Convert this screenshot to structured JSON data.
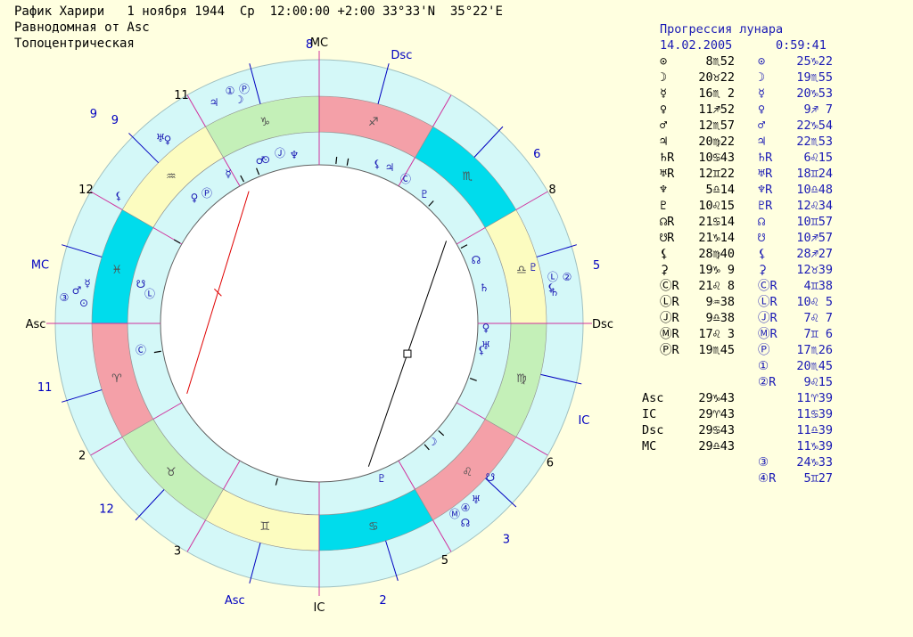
{
  "header": {
    "line1": "Рафик Харири   1 ноября 1944  Ср  12:00:00 +2:00 33°33'N  35°22'E",
    "line2": "Равнодомная от Asc",
    "line3": "Топоцентрическая"
  },
  "colors": {
    "background": "#ffffe0",
    "outer_ring": "#d4f8f8",
    "fire": "#f4a0a8",
    "earth": "#c4f0b8",
    "air": "#fcfcc0",
    "water": "#00dcec",
    "inner_fill": "#ffffff",
    "cusp_line": "#d0309c",
    "blue_line": "#0000c0",
    "planet_text": "#1a1ab4"
  },
  "chart": {
    "outer_house_labels": [
      "8",
      "9",
      "6",
      "5",
      "IC",
      "6",
      "3",
      "5",
      "2",
      "IC",
      "Asc",
      "3",
      "12",
      "2",
      "11",
      "Asc",
      "MC",
      "12",
      "9",
      "11",
      "MC",
      "Dsc",
      "8"
    ],
    "sign_glyphs": [
      "♈",
      "♉",
      "♊",
      "♋",
      "♌",
      "♍",
      "♎",
      "♏",
      "♐",
      "♑",
      "♒",
      "♓"
    ],
    "natal_glyphs": [
      "①",
      "Ⓟ",
      "☽",
      "♃",
      "♅",
      "♀",
      "⚸",
      "⚸",
      "♄",
      "♇",
      "Ⓛ",
      "②",
      "③",
      "♂",
      "☿",
      "⊙",
      "♀",
      "☋",
      "Ⓛ",
      "Ⓒ",
      "Ⓜ",
      "④",
      "☊",
      "♅",
      "☋",
      "⚸",
      "♀",
      "Ⓟ",
      "☿",
      "♂",
      "⊙",
      "Ⓙ",
      "♆",
      "⚸",
      "♃",
      "Ⓒ",
      "♇",
      "☊",
      "♄",
      "♅",
      "☽",
      "♇"
    ]
  },
  "table": {
    "title": "Прогрессия лунара",
    "date": "14.02.2005",
    "time": "0:59:41",
    "rows": [
      {
        "g1": "⊙",
        "v1": "8♏52",
        "g2": "⊙",
        "v2": "25♑22"
      },
      {
        "g1": "☽",
        "v1": "20♉22",
        "g2": "☽",
        "v2": "19♏55"
      },
      {
        "g1": "☿",
        "v1": "16♏ 2",
        "g2": "☿",
        "v2": "20♑53"
      },
      {
        "g1": "♀",
        "v1": "11♐52",
        "g2": "♀",
        "v2": "9♐ 7"
      },
      {
        "g1": "♂",
        "v1": "12♏57",
        "g2": "♂",
        "v2": "22♑54"
      },
      {
        "g1": "♃",
        "v1": "20♍22",
        "g2": "♃",
        "v2": "22♏53"
      },
      {
        "g1": "♄R",
        "v1": "10♋43",
        "g2": "♄R",
        "v2": "6♌15"
      },
      {
        "g1": "♅R",
        "v1": "12♊22",
        "g2": "♅R",
        "v2": "18♊24"
      },
      {
        "g1": "♆",
        "v1": "5♎14",
        "g2": "♆R",
        "v2": "10♎48"
      },
      {
        "g1": "♇",
        "v1": "10♌15",
        "g2": "♇R",
        "v2": "12♌34"
      },
      {
        "g1": "☊R",
        "v1": "21♋14",
        "g2": "☊",
        "v2": "10♊57"
      },
      {
        "g1": "☋R",
        "v1": "21♑14",
        "g2": "☋",
        "v2": "10♐57"
      },
      {
        "g1": "⚸",
        "v1": "28♍40",
        "g2": "⚸",
        "v2": "28♐27"
      },
      {
        "g1": "⚳",
        "v1": "19♑ 9",
        "g2": "⚳",
        "v2": "12♉39"
      },
      {
        "g1": "ⒸR",
        "v1": "21♌ 8",
        "g2": "ⒸR",
        "v2": "4♊38"
      },
      {
        "g1": "ⓁR",
        "v1": "9♒38",
        "g2": "ⓁR",
        "v2": "10♌ 5"
      },
      {
        "g1": "ⒿR",
        "v1": "9♎38",
        "g2": "ⒿR",
        "v2": "7♌ 7"
      },
      {
        "g1": "ⓂR",
        "v1": "17♌ 3",
        "g2": "ⓂR",
        "v2": "7♊ 6"
      },
      {
        "g1": "ⓅR",
        "v1": "19♏45",
        "g2": "Ⓟ",
        "v2": "17♏26"
      },
      {
        "g1": "",
        "v1": "",
        "g2": "①",
        "v2": "20♏45"
      },
      {
        "g1": "",
        "v1": "",
        "g2": "②R",
        "v2": "9♌15"
      }
    ],
    "angles": [
      {
        "name": "Asc",
        "v1": "29♑43",
        "v2": "11♈39"
      },
      {
        "name": "IC",
        "v1": "29♈43",
        "v2": "11♋39"
      },
      {
        "name": "Dsc",
        "v1": "29♋43",
        "v2": "11♎39"
      },
      {
        "name": "MC",
        "v1": "29♎43",
        "v2": "11♑39"
      }
    ],
    "extra": [
      {
        "g2": "③",
        "v2": "24♑33"
      },
      {
        "g2": "④R",
        "v2": "5♊27"
      }
    ]
  }
}
